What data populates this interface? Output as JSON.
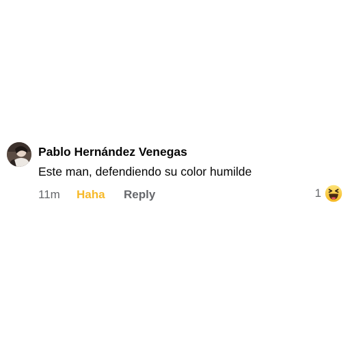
{
  "comment": {
    "author": "Pablo Hernández Venegas",
    "text": "Este man, defendiendo su color humilde",
    "avatar_icon": "user-avatar-photo",
    "actions": {
      "time": "11m",
      "reaction_label": "Haha",
      "reply_label": "Reply"
    },
    "reactions": {
      "count": "1",
      "icon": "haha-emoji-icon"
    }
  },
  "colors": {
    "text": "#050505",
    "secondary": "#65676b",
    "haha": "#f7b928"
  }
}
